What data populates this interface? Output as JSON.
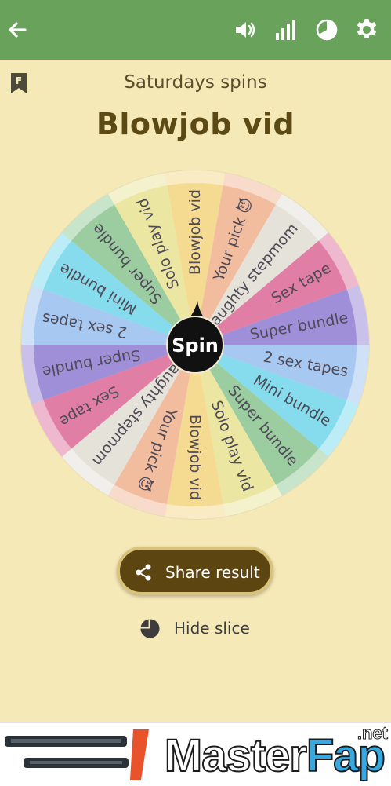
{
  "header": {
    "back_icon": "arrow-left-icon",
    "actions": [
      "volume-icon",
      "bar-chart-icon",
      "pie-chart-icon",
      "gear-icon"
    ],
    "color": "#69a25b"
  },
  "wheel_name": "Saturdays spins",
  "bookmark_letter": "F",
  "result": "Blowjob vid",
  "wheel": {
    "center_label": "Spin",
    "slices": [
      {
        "label": "Blowjob vid",
        "color": "#f4db91"
      },
      {
        "label": "Your pick 😈",
        "color": "#f2bd9f"
      },
      {
        "label": "Naughty stepmom",
        "color": "#e5e2da"
      },
      {
        "label": "Sex tape",
        "color": "#e07ea5"
      },
      {
        "label": "Super bundle",
        "color": "#9f8fd8"
      },
      {
        "label": "2 sex tapes",
        "color": "#a7c8f1"
      },
      {
        "label": "Mini bundle",
        "color": "#86dcec"
      },
      {
        "label": "Super bundle",
        "color": "#9bcda1"
      },
      {
        "label": "Solo play vid",
        "color": "#ebe7a3"
      },
      {
        "label": "Blowjob vid",
        "color": "#f4db91"
      },
      {
        "label": "Your pick 😈",
        "color": "#f2bd9f"
      },
      {
        "label": "Naughty stepmom",
        "color": "#e5e2da"
      },
      {
        "label": "Sex tape",
        "color": "#e07ea5"
      },
      {
        "label": "Super bundle",
        "color": "#9f8fd8"
      },
      {
        "label": "2 sex tapes",
        "color": "#a7c8f1"
      },
      {
        "label": "Mini bundle",
        "color": "#86dcec"
      },
      {
        "label": "Super bundle",
        "color": "#9bcda1"
      },
      {
        "label": "Solo play vid",
        "color": "#ebe7a3"
      }
    ]
  },
  "actions": {
    "share_label": "Share result",
    "hide_slice_label": "Hide slice"
  },
  "ad": {
    "brand_a": "Master",
    "brand_b": "Fap",
    "tld": ".net"
  }
}
